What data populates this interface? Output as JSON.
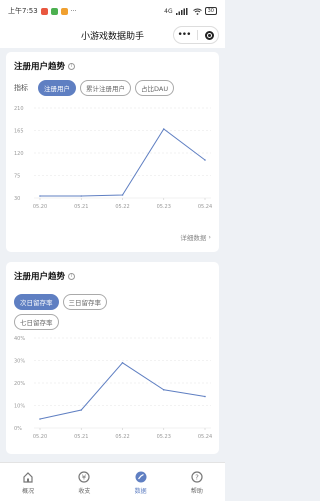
{
  "status_bar": {
    "time": "上午7:53",
    "signal": "4G",
    "battery": "30"
  },
  "app_title": "小游戏数据助手",
  "trend_card": {
    "title": "注册用户趋势",
    "metric_label": "指标",
    "metrics": [
      {
        "label": "注册用户",
        "active": true
      },
      {
        "label": "累计注册用户",
        "active": false
      },
      {
        "label": "占比DAU",
        "active": false
      }
    ],
    "detail_link": "详细数据"
  },
  "retention_card": {
    "title": "注册用户趋势",
    "metrics": [
      {
        "label": "次日留存率",
        "active": true
      },
      {
        "label": "三日留存率",
        "active": false
      },
      {
        "label": "七日留存率",
        "active": false
      }
    ]
  },
  "chart_data": [
    {
      "type": "line",
      "x": [
        "05.20",
        "05.21",
        "05.22",
        "05.23",
        "05.24"
      ],
      "yticks": [
        "210",
        "165",
        "120",
        "75",
        "30"
      ],
      "ylim": [
        30,
        210
      ],
      "series": [
        {
          "values": [
            34,
            34,
            36,
            168,
            106
          ]
        }
      ],
      "grid": true,
      "color": "#5f7fc2"
    },
    {
      "type": "line",
      "x": [
        "05.20",
        "05.21",
        "05.22",
        "05.23",
        "05.24"
      ],
      "yticks": [
        "40%",
        "30%",
        "20%",
        "10%",
        "0%"
      ],
      "ylim": [
        0,
        40
      ],
      "series": [
        {
          "values": [
            4,
            8,
            29,
            17,
            14
          ]
        }
      ],
      "grid": true,
      "color": "#5f7fc2"
    }
  ],
  "tabs": [
    {
      "label": "概况",
      "icon": "home-icon",
      "active": false
    },
    {
      "label": "收支",
      "icon": "yen-icon",
      "active": false
    },
    {
      "label": "数据",
      "icon": "data-icon",
      "active": true
    },
    {
      "label": "帮助",
      "icon": "help-icon",
      "active": false
    }
  ]
}
